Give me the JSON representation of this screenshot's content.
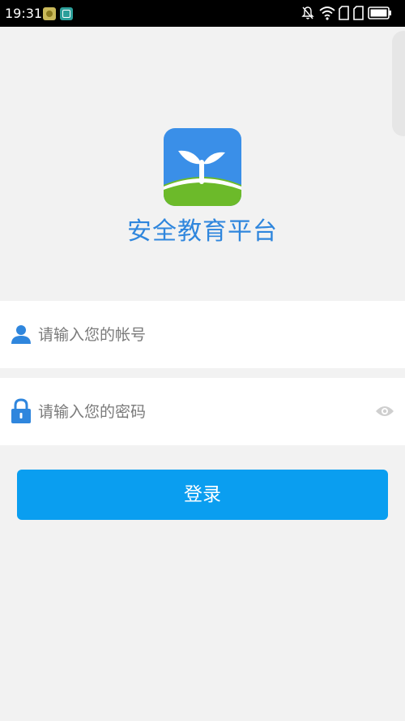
{
  "status_bar": {
    "time": "19:31",
    "icons": [
      "app-notification-icon",
      "scan-notification-icon",
      "mute-bell-icon",
      "wifi-icon",
      "sim-card-icon",
      "sim-card-icon",
      "battery-icon"
    ]
  },
  "app": {
    "title": "安全教育平台",
    "logo": "sprout-logo"
  },
  "login_form": {
    "account_placeholder": "请输入您的帐号",
    "password_placeholder": "请输入您的密码",
    "login_label": "登录"
  },
  "colors": {
    "accent": "#0a9ef0",
    "title": "#2f86dd",
    "icon": "#2f86dd",
    "background": "#f2f2f2"
  }
}
